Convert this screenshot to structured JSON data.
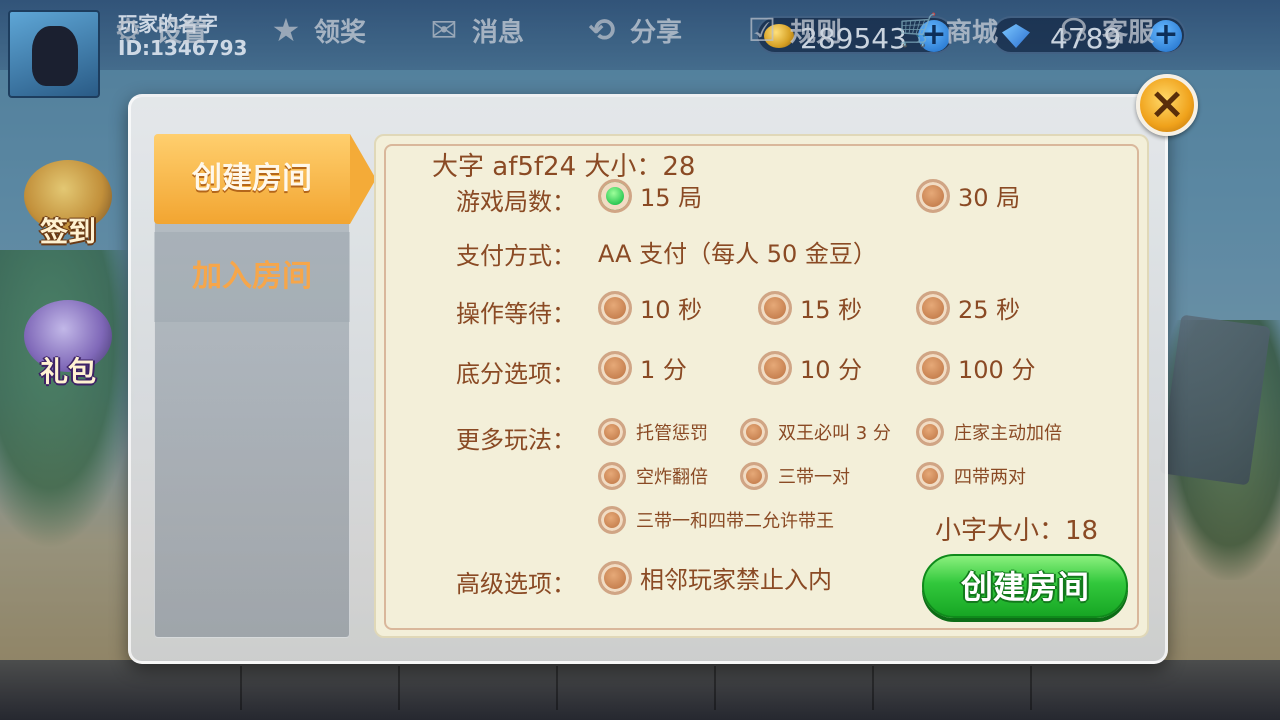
{
  "player": {
    "name": "玩家的名字",
    "id": "ID:1346793"
  },
  "currency": {
    "gold": "289543",
    "gems": "4789",
    "plus": "+"
  },
  "side": {
    "signin": "签到",
    "gift": "礼包"
  },
  "tabs": {
    "create": "创建房间",
    "join": "加入房间"
  },
  "notes": {
    "big": "大字 af5f24  大小：28",
    "small": "小字大小：18"
  },
  "rows": {
    "rounds": {
      "label": "游戏局数：",
      "options": [
        "15 局",
        "30 局"
      ],
      "selected": 0
    },
    "payment": {
      "label": "支付方式：",
      "value": "AA 支付（每人 50 金豆）"
    },
    "wait": {
      "label": "操作等待：",
      "options": [
        "10 秒",
        "15 秒",
        "25 秒"
      ]
    },
    "base": {
      "label": "底分选项：",
      "options": [
        "1 分",
        "10 分",
        "100 分"
      ]
    },
    "more": {
      "label": "更多玩法：",
      "options": [
        "托管惩罚",
        "双王必叫 3 分",
        "庄家主动加倍",
        "空炸翻倍",
        "三带一对",
        "四带两对",
        "三带一和四带二允许带王"
      ]
    },
    "advanced": {
      "label": "高级选项：",
      "options": [
        "相邻玩家禁止入内"
      ]
    }
  },
  "create_button": "创建房间",
  "close": "×",
  "bottom_nav": [
    "设置",
    "领奖",
    "消息",
    "分享",
    "规则",
    "商城",
    "客服"
  ],
  "colors": {
    "text_brown": "#8a4a24",
    "tab_orange": "#f4ab38",
    "green_button": "#32c83c",
    "panel_cream": "#f3efd9"
  }
}
